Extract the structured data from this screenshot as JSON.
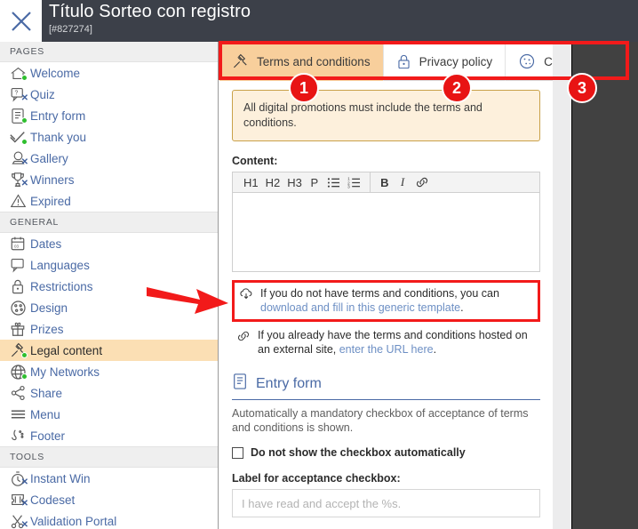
{
  "header": {
    "close_icon": "close-x-icon",
    "title": "Título Sorteo con registro",
    "subtitle": "[#827274]"
  },
  "sidebar": {
    "sections": [
      {
        "label": "PAGES",
        "items": [
          {
            "label": "Welcome",
            "icon": "home-icon",
            "status": "on",
            "active": false
          },
          {
            "label": "Quiz",
            "icon": "question-icon",
            "status": "off",
            "active": false
          },
          {
            "label": "Entry form",
            "icon": "form-icon",
            "status": "on",
            "active": false
          },
          {
            "label": "Thank you",
            "icon": "check-icon",
            "status": "on",
            "active": false
          },
          {
            "label": "Gallery",
            "icon": "gallery-icon",
            "status": "off",
            "active": false
          },
          {
            "label": "Winners",
            "icon": "trophy-icon",
            "status": "off",
            "active": false
          },
          {
            "label": "Expired",
            "icon": "warning-icon",
            "status": "none",
            "active": false
          }
        ]
      },
      {
        "label": "GENERAL",
        "items": [
          {
            "label": "Dates",
            "icon": "calendar-icon",
            "status": "none",
            "active": false
          },
          {
            "label": "Languages",
            "icon": "speech-icon",
            "status": "none",
            "active": false
          },
          {
            "label": "Restrictions",
            "icon": "lock-icon",
            "status": "none",
            "active": false
          },
          {
            "label": "Design",
            "icon": "palette-icon",
            "status": "none",
            "active": false
          },
          {
            "label": "Prizes",
            "icon": "gift-icon",
            "status": "none",
            "active": false
          },
          {
            "label": "Legal content",
            "icon": "gavel-icon",
            "status": "on",
            "active": true
          },
          {
            "label": "My Networks",
            "icon": "network-icon",
            "status": "on",
            "active": false
          },
          {
            "label": "Share",
            "icon": "share-icon",
            "status": "none",
            "active": false
          },
          {
            "label": "Menu",
            "icon": "menu-icon",
            "status": "none",
            "active": false
          },
          {
            "label": "Footer",
            "icon": "footer-icon",
            "status": "none",
            "active": false
          }
        ]
      },
      {
        "label": "TOOLS",
        "items": [
          {
            "label": "Instant Win",
            "icon": "stopwatch-icon",
            "status": "off",
            "active": false
          },
          {
            "label": "Codeset",
            "icon": "ticket-icon",
            "status": "off",
            "active": false
          },
          {
            "label": "Validation Portal",
            "icon": "scissors-icon",
            "status": "off",
            "active": false
          }
        ]
      }
    ]
  },
  "main": {
    "tabs": [
      {
        "label": "Terms and conditions",
        "icon": "gavel-icon",
        "active": true
      },
      {
        "label": "Privacy policy",
        "icon": "lock-icon",
        "active": false
      },
      {
        "label": "Cookies policy",
        "icon": "cookie-icon",
        "active": false
      }
    ],
    "notice": "All digital promotions must include the terms and conditions.",
    "content_label": "Content:",
    "editor_toolbar": [
      {
        "label": "H1",
        "name": "heading-1-button"
      },
      {
        "label": "H2",
        "name": "heading-2-button"
      },
      {
        "label": "H3",
        "name": "heading-3-button"
      },
      {
        "label": "P",
        "name": "paragraph-button"
      },
      {
        "label": "☰",
        "name": "bullet-list-button"
      },
      {
        "label": "☰",
        "name": "numbered-list-button"
      },
      {
        "label": "B",
        "name": "bold-button"
      },
      {
        "label": "I",
        "name": "italic-button"
      },
      {
        "label": "🔗",
        "name": "link-button"
      }
    ],
    "editor_value": "",
    "hint_download": {
      "icon": "cloud-download-icon",
      "text_before": "If you do not have terms and conditions, you can ",
      "link": "download and fill in this generic template",
      "text_after": "."
    },
    "hint_external": {
      "icon": "link-icon",
      "text_before": "If you already have the terms and conditions hosted on an external site, ",
      "link": "enter the URL here",
      "text_after": "."
    },
    "entry_form": {
      "icon": "form-icon",
      "title": "Entry form",
      "description": "Automatically a mandatory checkbox of acceptance of terms and conditions is shown.",
      "checkbox_label": "Do not show the checkbox automatically",
      "checkbox_checked": false,
      "acceptance_label": "Label for acceptance checkbox:",
      "acceptance_value": "",
      "acceptance_placeholder": "I have read and accept the %s."
    }
  },
  "annotations": {
    "badges": [
      {
        "text": "1"
      },
      {
        "text": "2"
      },
      {
        "text": "3"
      }
    ],
    "arrow": "red-arrow-pointer",
    "highlight_color": "#f21a1a"
  }
}
